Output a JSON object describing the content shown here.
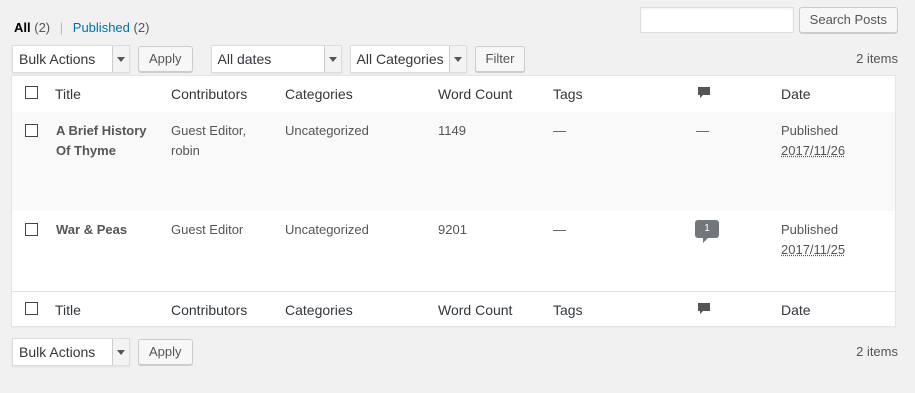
{
  "views": {
    "all_label": "All",
    "all_count": "(2)",
    "separator": "|",
    "published_label": "Published",
    "published_count": "(2)"
  },
  "search": {
    "placeholder": "",
    "button_label": "Search Posts"
  },
  "top_nav": {
    "bulk_action": "Bulk Actions",
    "apply_label": "Apply",
    "date_filter": "All dates",
    "category_filter": "All Categories",
    "filter_label": "Filter",
    "items_count": "2 items"
  },
  "columns": {
    "title": "Title",
    "contributors": "Contributors",
    "categories": "Categories",
    "word_count": "Word Count",
    "tags": "Tags",
    "comments_icon": "comment-icon",
    "date": "Date"
  },
  "rows": [
    {
      "title": "A Brief History Of Thyme",
      "contributors": "Guest Editor, robin",
      "categories": "Uncategorized",
      "word_count": "1149",
      "tags": "—",
      "comments": "—",
      "status": "Published",
      "date": "2017/11/26"
    },
    {
      "title": "War & Peas",
      "contributors": "Guest Editor",
      "categories": "Uncategorized",
      "word_count": "9201",
      "tags": "—",
      "comments": "1",
      "status": "Published",
      "date": "2017/11/25"
    }
  ],
  "bottom_nav": {
    "bulk_action": "Bulk Actions",
    "apply_label": "Apply",
    "items_count": "2 items"
  },
  "colors": {
    "link": "#0073aa",
    "background": "#f1f1f1",
    "alt_row": "#f9f9f9",
    "comment_bubble": "#72777c"
  }
}
